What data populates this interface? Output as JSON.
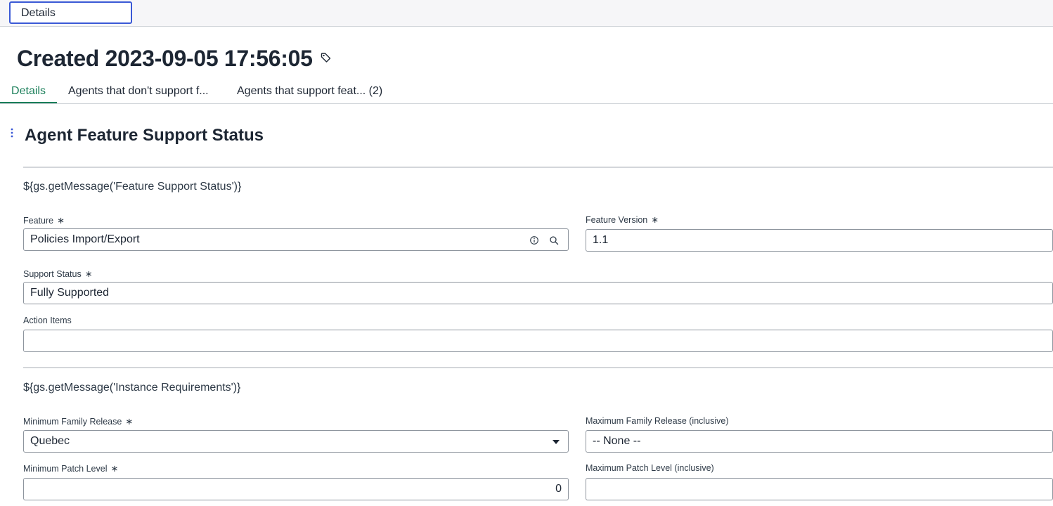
{
  "top_tab": {
    "label": "Details"
  },
  "record": {
    "title": "Created 2023-09-05 17:56:05"
  },
  "tabs": [
    {
      "label": "Details"
    },
    {
      "label": "Agents that don't support f..."
    },
    {
      "label": "Agents that support feat...  (2)"
    }
  ],
  "form": {
    "section_title": "Agent Feature Support Status",
    "subsection1": "${gs.getMessage('Feature Support Status')}",
    "subsection2": "${gs.getMessage('Instance Requirements')}",
    "required_mark": "∗",
    "fields": {
      "feature": {
        "label": "Feature",
        "value": "Policies Import/Export"
      },
      "feature_version": {
        "label": "Feature Version",
        "value": "1.1"
      },
      "support_status": {
        "label": "Support Status",
        "value": "Fully Supported"
      },
      "action_items": {
        "label": "Action Items",
        "value": ""
      },
      "min_family_release": {
        "label": "Minimum Family Release",
        "value": "Quebec"
      },
      "max_family_release": {
        "label": "Maximum Family Release (inclusive)",
        "value": "-- None --"
      },
      "min_patch_level": {
        "label": "Minimum Patch Level",
        "value": "0"
      },
      "max_patch_level": {
        "label": "Maximum Patch Level (inclusive)",
        "value": ""
      }
    }
  },
  "icons": {
    "tag": "tag-icon",
    "info": "info-icon",
    "search": "search-icon",
    "menu": "vertical-dots-icon",
    "dropdown": "chevron-down-icon"
  },
  "colors": {
    "accent": "#1b7f5a",
    "focus": "#3a59d6",
    "menu_dots": "#3a59d6"
  }
}
